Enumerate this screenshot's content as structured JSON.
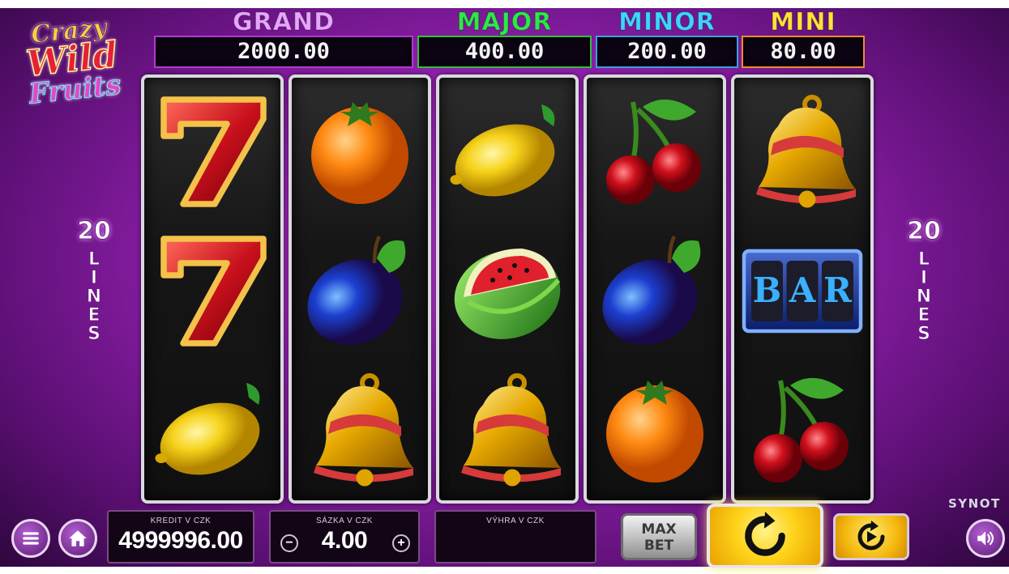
{
  "logo": {
    "line1": "Crazy",
    "line2": "Wild",
    "line3": "Fruits"
  },
  "jackpots": [
    {
      "title": "GRAND",
      "value": "2000.00",
      "title_color": "#e7a5ff",
      "border": "#b338d6"
    },
    {
      "title": "MAJOR",
      "value": "400.00",
      "title_color": "#2ee84a",
      "border": "#2fbf3f"
    },
    {
      "title": "MINOR",
      "value": "200.00",
      "title_color": "#3fd4ff",
      "border": "#3a9fe0"
    },
    {
      "title": "MINI",
      "value": "80.00",
      "title_color": "#ffe23a",
      "border": "#f08a2a"
    }
  ],
  "lines": {
    "count": "20",
    "letters": [
      "L",
      "I",
      "N",
      "E",
      "S"
    ]
  },
  "reels": [
    [
      "seven",
      "seven",
      "lemon"
    ],
    [
      "orange",
      "plum",
      "bell"
    ],
    [
      "lemon",
      "watermelon",
      "bell"
    ],
    [
      "cherry",
      "plum",
      "orange"
    ],
    [
      "bell",
      "bar",
      "cherry"
    ]
  ],
  "bar_symbol_text": "BAR",
  "panel": {
    "credit_label": "KREDIT V CZK",
    "credit_value": "4999996.00",
    "bet_label": "SÁZKA V CZK",
    "bet_value": "4.00",
    "minus": "−",
    "plus": "+",
    "win_label": "VÝHRA V CZK",
    "win_value": "",
    "maxbet_line1": "MAX",
    "maxbet_line2": "BET"
  },
  "brand": "SYNOT",
  "icons": {
    "menu": "menu-icon",
    "home": "home-icon",
    "spin": "spin-icon",
    "autoplay": "autoplay-icon",
    "sound": "speaker-icon"
  }
}
